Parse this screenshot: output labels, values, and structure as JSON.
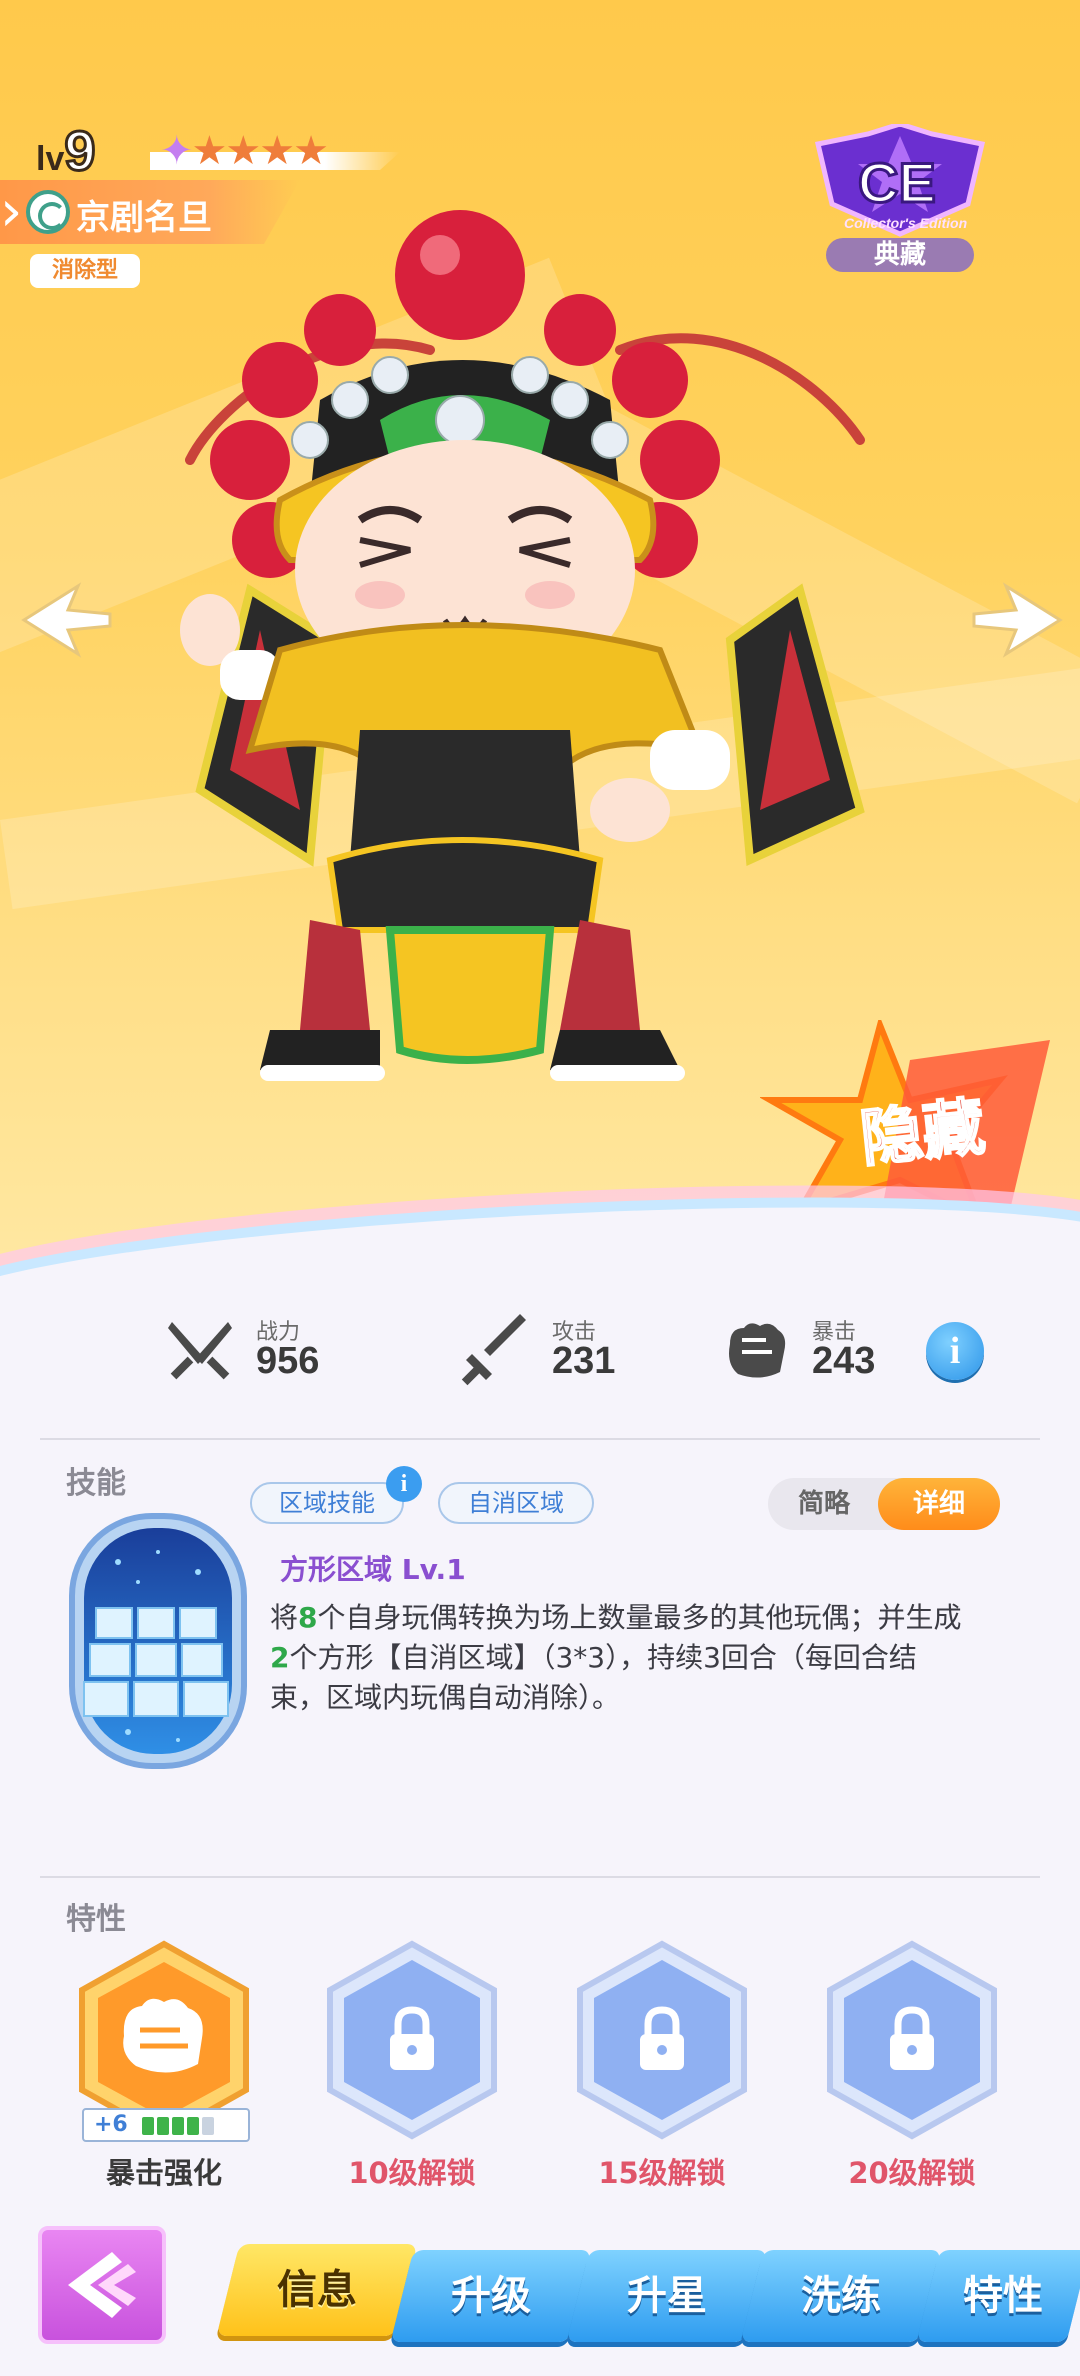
{
  "hero": {
    "level_prefix": "lv",
    "level": "9",
    "stars_total": 5,
    "character_name": "京剧名旦",
    "character_type": "消除型",
    "edition_badge": "典藏",
    "edition_badge_small": "Collector's Edition",
    "rarity_badge": "隐藏"
  },
  "stats": [
    {
      "label": "战力",
      "value": "956",
      "icon": "crossed-swords-icon"
    },
    {
      "label": "攻击",
      "value": "231",
      "icon": "sword-icon"
    },
    {
      "label": "暴击",
      "value": "243",
      "icon": "fist-icon"
    }
  ],
  "stats_info_icon": "i",
  "skill": {
    "section_title": "技能",
    "tags": [
      "区域技能",
      "自消区域"
    ],
    "tag_info": "i",
    "toggle": {
      "simple": "简略",
      "detail": "详细",
      "selected": "详细"
    },
    "name": "方形区域 Lv.1",
    "desc_parts": {
      "p1": "将",
      "n1": "8",
      "p2": "个自身玩偶转换为场上数量最多的其他玩偶；并生成",
      "n2": "2",
      "p3": "个方形【自消区域】（3*3），持续3回合（每回合结束，区域内玩偶自动消除）。"
    }
  },
  "traits": {
    "section_title": "特性",
    "items": [
      {
        "label": "暴击强化",
        "locked": false,
        "icon": "fist-icon",
        "level_text": "+6",
        "progress_filled": 4,
        "progress_total": 5
      },
      {
        "label": "10级解锁",
        "locked": true,
        "icon": "lock-icon"
      },
      {
        "label": "15级解锁",
        "locked": true,
        "icon": "lock-icon"
      },
      {
        "label": "20级解锁",
        "locked": true,
        "icon": "lock-icon"
      }
    ]
  },
  "nav": {
    "tabs": [
      "信息",
      "升级",
      "升星",
      "洗练",
      "特性"
    ],
    "active": "信息"
  },
  "colors": {
    "hero_bg": "#ffc94b",
    "accent_orange": "#ff8c1a",
    "accent_blue": "#2e9cf0",
    "locked_red": "#e0556a",
    "highlight_green": "#2fa84a",
    "skill_name_purple": "#8a4fd0"
  }
}
